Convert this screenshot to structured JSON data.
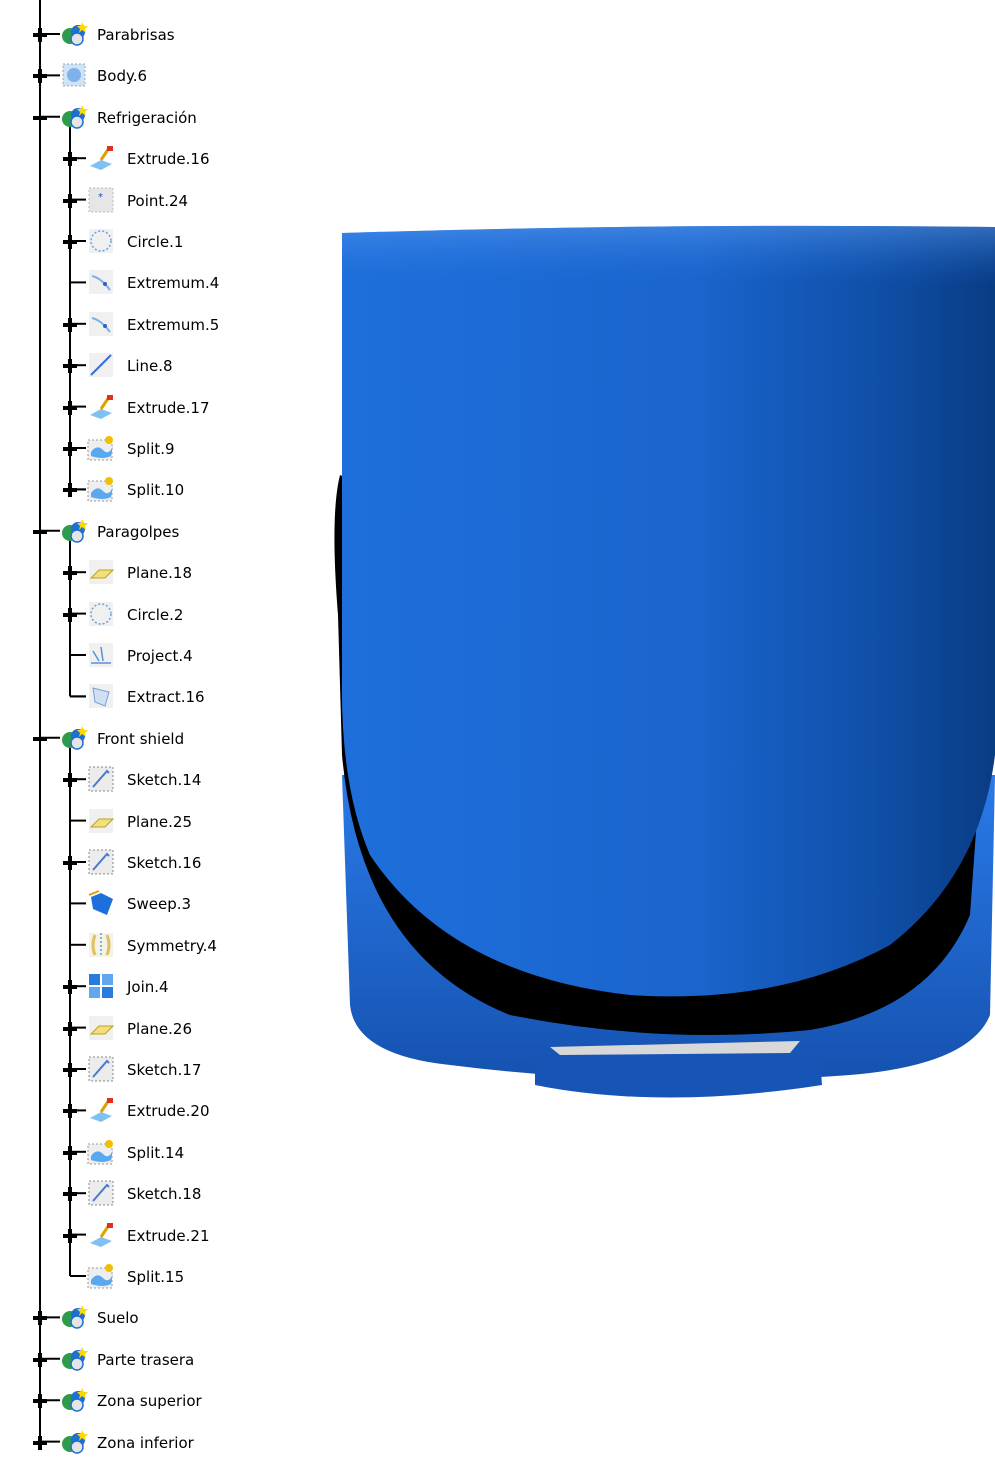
{
  "tree": {
    "nodes": [
      {
        "label": "Parabrisas",
        "level": 0,
        "icon": "geometrical-set-icon",
        "expander": "plus"
      },
      {
        "label": "Body.6",
        "level": 0,
        "icon": "body-icon",
        "expander": "plus"
      },
      {
        "label": "Refrigeración",
        "level": 0,
        "icon": "geometrical-set-icon",
        "expander": "minus"
      },
      {
        "label": "Extrude.16",
        "level": 1,
        "icon": "extrude-icon",
        "expander": "plus"
      },
      {
        "label": "Point.24",
        "level": 1,
        "icon": "point-icon",
        "expander": "plus"
      },
      {
        "label": "Circle.1",
        "level": 1,
        "icon": "circle-icon",
        "expander": "plus"
      },
      {
        "label": "Extremum.4",
        "level": 1,
        "icon": "extremum-icon",
        "expander": "none"
      },
      {
        "label": "Extremum.5",
        "level": 1,
        "icon": "extremum-icon",
        "expander": "plus"
      },
      {
        "label": "Line.8",
        "level": 1,
        "icon": "line-icon",
        "expander": "plus"
      },
      {
        "label": "Extrude.17",
        "level": 1,
        "icon": "extrude-icon",
        "expander": "plus"
      },
      {
        "label": "Split.9",
        "level": 1,
        "icon": "split-icon",
        "expander": "plus"
      },
      {
        "label": "Split.10",
        "level": 1,
        "icon": "split-icon",
        "expander": "plus"
      },
      {
        "label": "Paragolpes",
        "level": 0,
        "icon": "geometrical-set-icon",
        "expander": "minus"
      },
      {
        "label": "Plane.18",
        "level": 1,
        "icon": "plane-icon",
        "expander": "plus"
      },
      {
        "label": "Circle.2",
        "level": 1,
        "icon": "circle-icon",
        "expander": "plus"
      },
      {
        "label": "Project.4",
        "level": 1,
        "icon": "project-icon",
        "expander": "none"
      },
      {
        "label": "Extract.16",
        "level": 1,
        "icon": "extract-icon",
        "expander": "none"
      },
      {
        "label": "Front shield",
        "level": 0,
        "icon": "geometrical-set-icon",
        "expander": "minus"
      },
      {
        "label": "Sketch.14",
        "level": 1,
        "icon": "sketch-icon",
        "expander": "plus"
      },
      {
        "label": "Plane.25",
        "level": 1,
        "icon": "plane-icon",
        "expander": "none"
      },
      {
        "label": "Sketch.16",
        "level": 1,
        "icon": "sketch-icon",
        "expander": "plus"
      },
      {
        "label": "Sweep.3",
        "level": 1,
        "icon": "sweep-icon",
        "expander": "none"
      },
      {
        "label": "Symmetry.4",
        "level": 1,
        "icon": "symmetry-icon",
        "expander": "none"
      },
      {
        "label": "Join.4",
        "level": 1,
        "icon": "join-icon",
        "expander": "plus"
      },
      {
        "label": "Plane.26",
        "level": 1,
        "icon": "plane-icon",
        "expander": "plus"
      },
      {
        "label": "Sketch.17",
        "level": 1,
        "icon": "sketch-icon",
        "expander": "plus"
      },
      {
        "label": "Extrude.20",
        "level": 1,
        "icon": "extrude-icon",
        "expander": "plus"
      },
      {
        "label": "Split.14",
        "level": 1,
        "icon": "split-icon",
        "expander": "plus"
      },
      {
        "label": "Sketch.18",
        "level": 1,
        "icon": "sketch-icon",
        "expander": "plus"
      },
      {
        "label": "Extrude.21",
        "level": 1,
        "icon": "extrude-icon",
        "expander": "plus"
      },
      {
        "label": "Split.15",
        "level": 1,
        "icon": "split-icon",
        "expander": "none"
      },
      {
        "label": "Suelo",
        "level": 0,
        "icon": "geometrical-set-icon",
        "expander": "plus"
      },
      {
        "label": "Parte trasera",
        "level": 0,
        "icon": "geometrical-set-icon",
        "expander": "plus"
      },
      {
        "label": "Zona superior",
        "level": 0,
        "icon": "geometrical-set-icon",
        "expander": "plus"
      },
      {
        "label": "Zona inferior",
        "level": 0,
        "icon": "geometrical-set-icon",
        "expander": "plus"
      }
    ]
  },
  "viewport": {
    "model_color": "#1a6ed8",
    "shadow_color": "#000000"
  }
}
